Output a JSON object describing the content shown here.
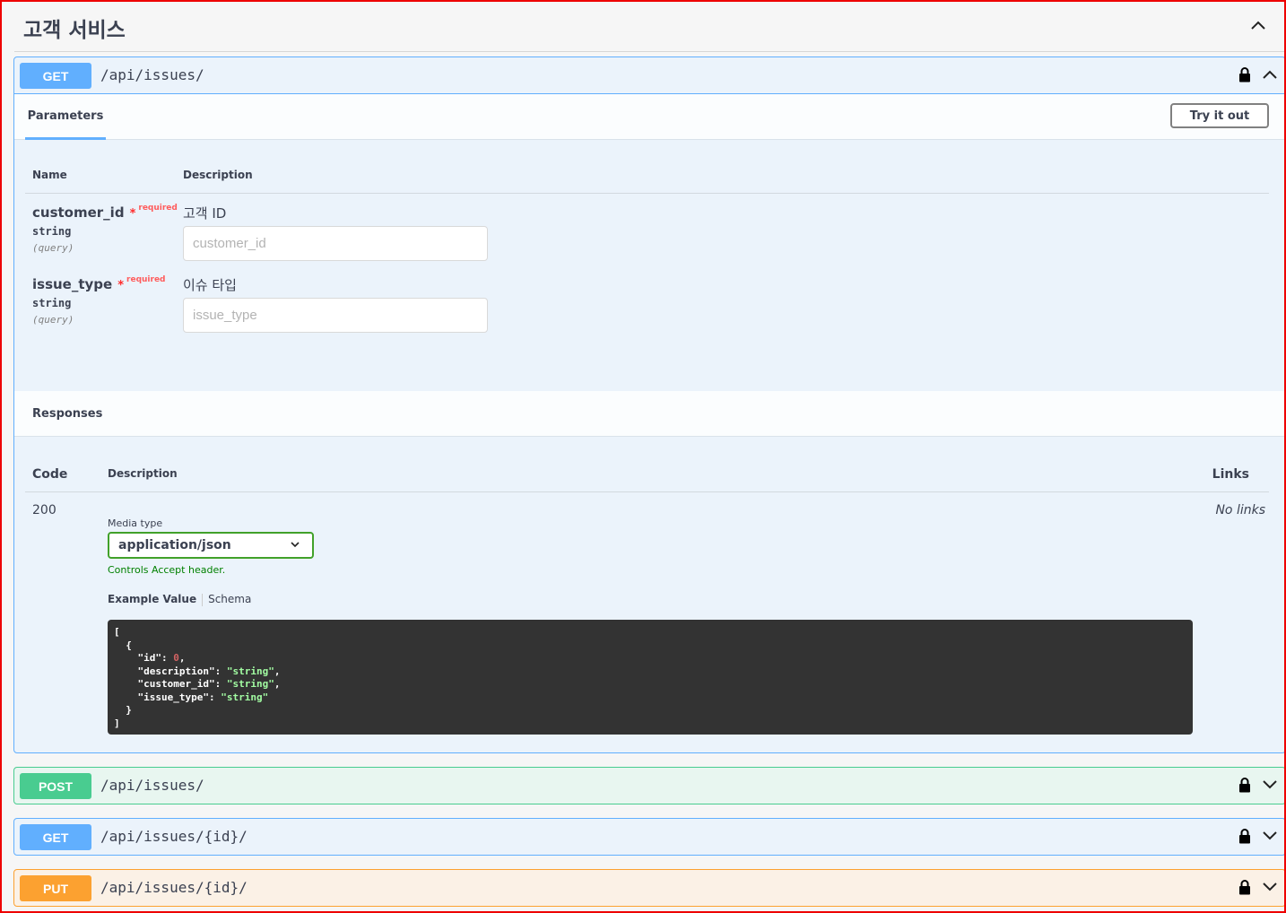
{
  "section": {
    "title": "고객 서비스"
  },
  "operations": [
    {
      "method": "GET",
      "path": "/api/issues/",
      "color": "#61affe",
      "expanded": true
    },
    {
      "method": "POST",
      "path": "/api/issues/",
      "color": "#49cc90",
      "expanded": false
    },
    {
      "method": "GET",
      "path": "/api/issues/{id}/",
      "color": "#61affe",
      "expanded": false
    },
    {
      "method": "PUT",
      "path": "/api/issues/{id}/",
      "color": "#fca130",
      "expanded": false
    }
  ],
  "params_panel": {
    "tab_label": "Parameters",
    "try_it_out": "Try it out",
    "col_name": "Name",
    "col_description": "Description",
    "star": "*",
    "required": "required",
    "items": [
      {
        "name": "customer_id",
        "type": "string",
        "in": "(query)",
        "description": "고객 ID",
        "placeholder": "customer_id"
      },
      {
        "name": "issue_type",
        "type": "string",
        "in": "(query)",
        "description": "이슈 타입",
        "placeholder": "issue_type"
      }
    ]
  },
  "responses_panel": {
    "title": "Responses",
    "col_code": "Code",
    "col_description": "Description",
    "col_links": "Links",
    "code": "200",
    "links": "No links",
    "media_type_label": "Media type",
    "media_type": "application/json",
    "controls_text": "Controls Accept header.",
    "tab_example": "Example Value",
    "tab_schema": "Schema",
    "example": [
      {
        "key": "id",
        "value": "0",
        "kind": "number"
      },
      {
        "key": "description",
        "value": "\"string\"",
        "kind": "string"
      },
      {
        "key": "customer_id",
        "value": "\"string\"",
        "kind": "string"
      },
      {
        "key": "issue_type",
        "value": "\"string\"",
        "kind": "string"
      }
    ]
  },
  "icons": [
    "chevron-up-icon",
    "chevron-down-icon",
    "lock-icon"
  ]
}
